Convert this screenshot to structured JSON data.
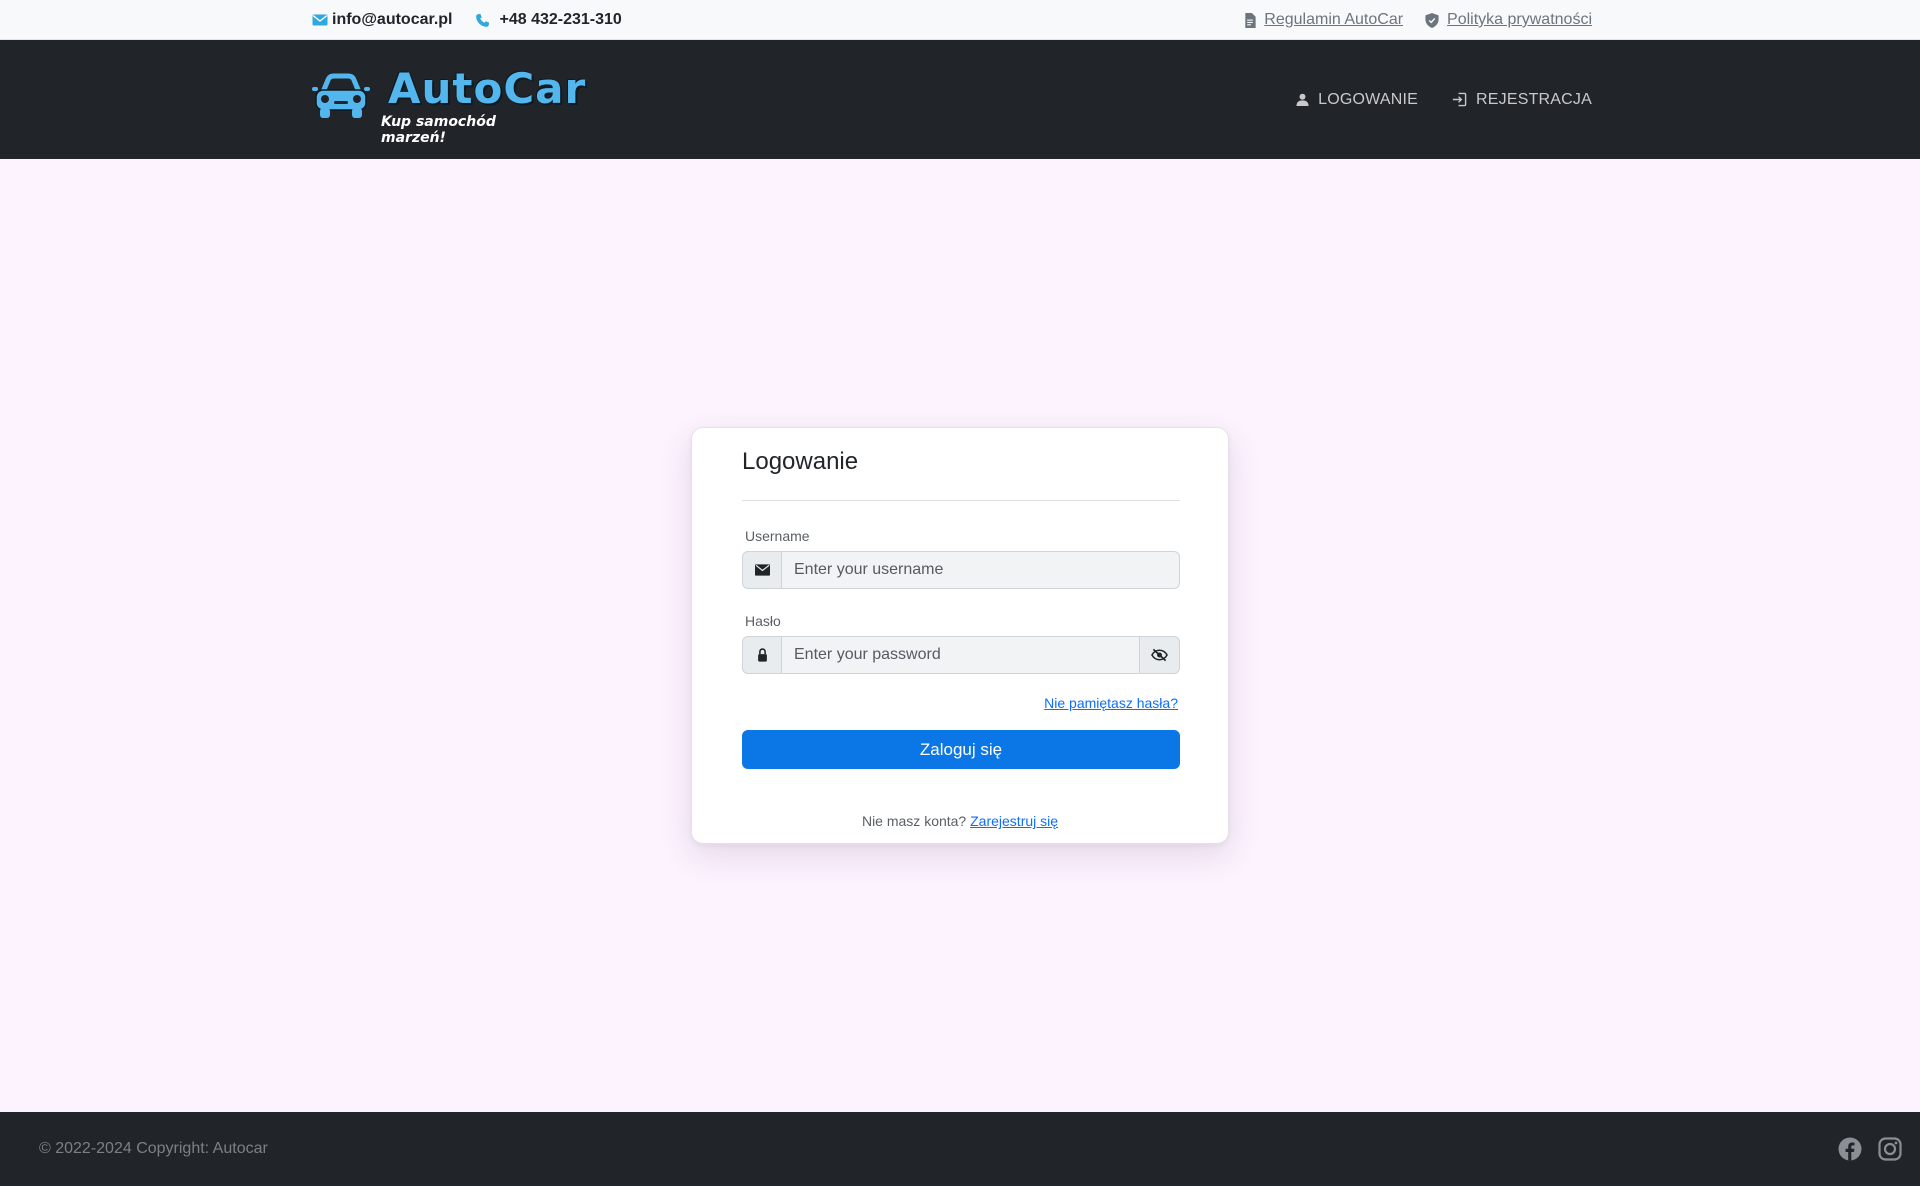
{
  "topbar": {
    "email": "info@autocar.pl",
    "phone": "+48 432-231-310",
    "terms_link": "Regulamin AutoCar",
    "privacy_link": "Polityka prywatności",
    "icons": [
      "envelope-icon",
      "phone-icon",
      "document-icon",
      "shield-icon"
    ],
    "accent_color": "#2fa8e0"
  },
  "navbar": {
    "brand_name": "AutoCar",
    "brand_tagline": "Kup samochód marzeń!",
    "login_label": "LOGOWANIE",
    "register_label": "REJESTRACJA",
    "icons": [
      "user-icon",
      "sign-in-icon"
    ],
    "brand_color": "#53b7ee"
  },
  "login": {
    "title": "Logowanie",
    "username_label": "Username",
    "username_placeholder": "Enter your username",
    "password_label": "Hasło",
    "password_placeholder": "Enter your password",
    "forgot_link": "Nie pamiętasz hasła?",
    "submit_label": "Zaloguj się",
    "no_account_text": "Nie masz konta?",
    "register_link": "Zarejestruj się",
    "icons": [
      "envelope-icon",
      "lock-icon",
      "eye-slash-icon"
    ],
    "primary_color": "#0b76e6"
  },
  "footer": {
    "copyright": "© 2022-2024 Copyright: Autocar",
    "icons": [
      "facebook-icon",
      "instagram-icon"
    ]
  }
}
